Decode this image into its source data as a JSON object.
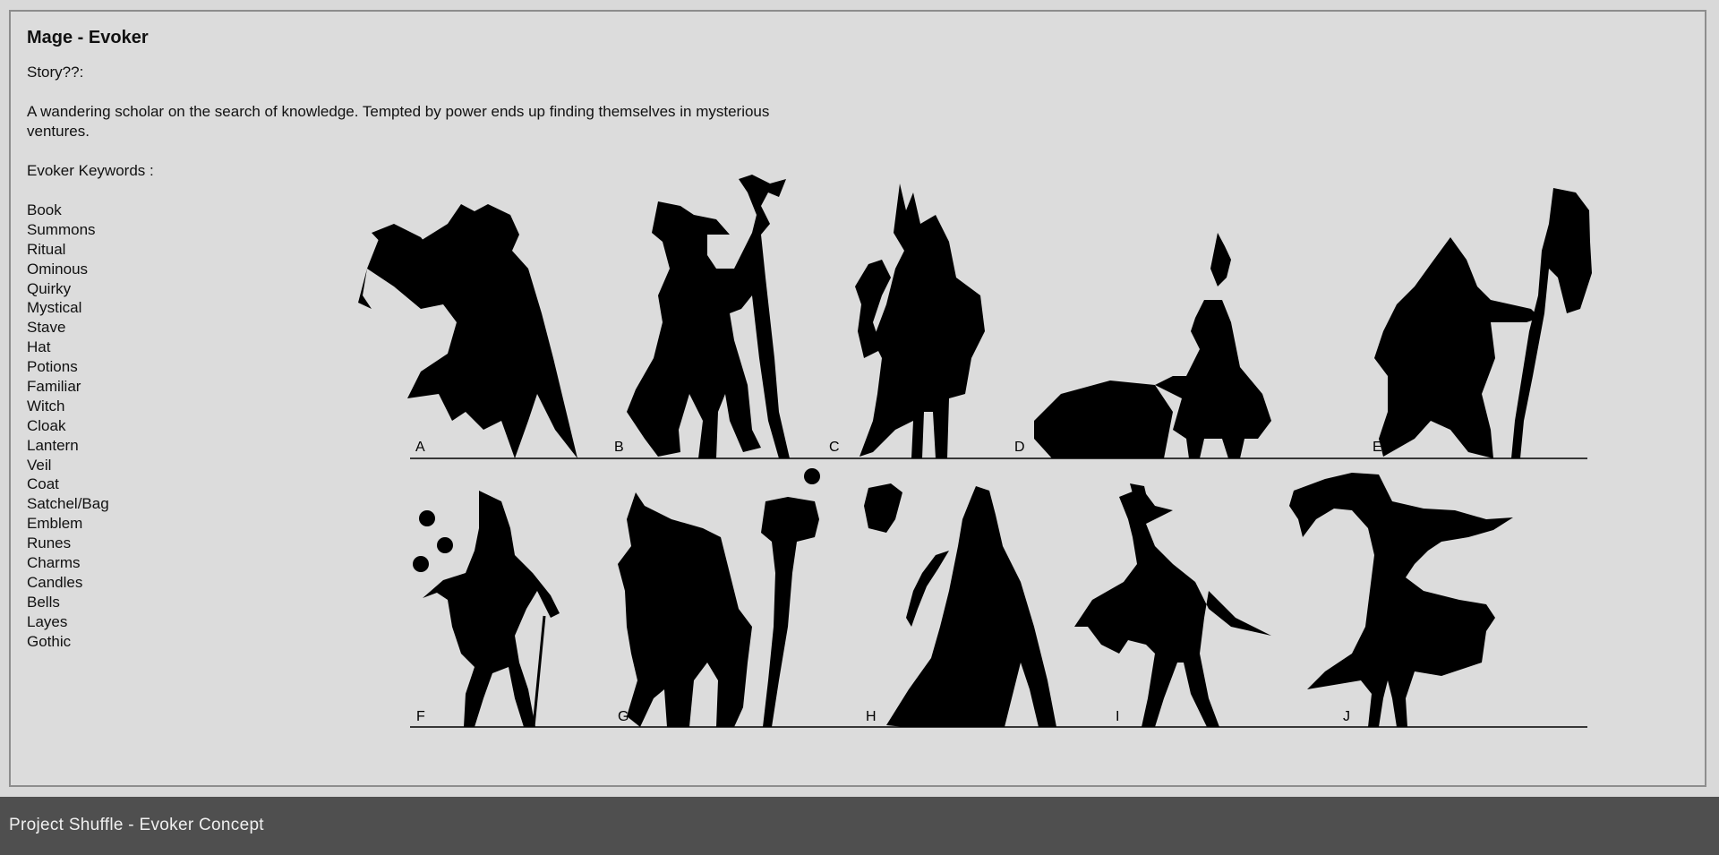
{
  "sheet": {
    "title": "Mage - Evoker",
    "story_label": "Story??:",
    "story_text": "A wandering scholar on the search of knowledge. Tempted by power ends up finding themselves in  mysterious ventures.",
    "keywords_label": "Evoker Keywords :",
    "keywords": [
      "Book",
      "Summons",
      "Ritual",
      "Ominous",
      "Quirky",
      "Mystical",
      "Stave",
      "Hat",
      "Potions",
      "Familiar",
      "Witch",
      "Cloak",
      "Lantern",
      "Veil",
      "Coat",
      "Satchel/Bag",
      "Emblem",
      "Runes",
      "Charms",
      "Candles",
      "Bells",
      "Layes",
      "Gothic"
    ]
  },
  "lineup": {
    "row1": [
      "A",
      "B",
      "C",
      "D",
      "E"
    ],
    "row2": [
      "F",
      "G",
      "H",
      "I",
      "J"
    ]
  },
  "footer": {
    "caption": "Project Shuffle - Evoker Concept"
  },
  "colors": {
    "background": "#dcdcdc",
    "frame_border": "#8d8d8d",
    "silhouette": "#000000",
    "footer_bar": "#4f4f4f"
  }
}
